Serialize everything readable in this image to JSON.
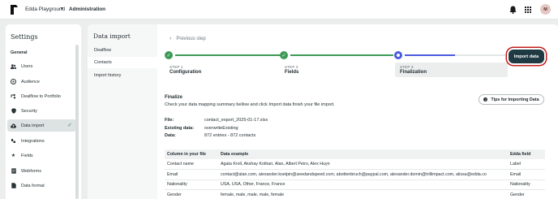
{
  "topbar": {
    "workspace": "Edda Playground",
    "section": "Administration",
    "avatar_initial": "M"
  },
  "settings": {
    "title": "Settings",
    "group": "General",
    "items": [
      {
        "label": "Users",
        "icon": "users-icon"
      },
      {
        "label": "Audience",
        "icon": "audience-icon"
      },
      {
        "label": "Dealflow to Portfolio",
        "icon": "flow-icon"
      },
      {
        "label": "Security",
        "icon": "shield-icon"
      },
      {
        "label": "Data import",
        "icon": "cloud-upload-icon",
        "active": true
      },
      {
        "label": "Integrations",
        "icon": "integrations-icon"
      },
      {
        "label": "Fields",
        "icon": "star-icon"
      },
      {
        "label": "Webforms",
        "icon": "form-icon"
      },
      {
        "label": "Data format",
        "icon": "document-icon"
      }
    ]
  },
  "subnav": {
    "title": "Data import",
    "items": [
      {
        "label": "Dealflow"
      },
      {
        "label": "Contacts",
        "active": true
      },
      {
        "label": "Import history"
      }
    ]
  },
  "main": {
    "previous_step": "Previous step",
    "steps": [
      {
        "num": "STEP 1",
        "name": "Configuration",
        "state": "done"
      },
      {
        "num": "STEP 2",
        "name": "Fields",
        "state": "done"
      },
      {
        "num": "STEP 3",
        "name": "Finalization",
        "state": "current"
      }
    ],
    "import_button": "Import data",
    "finalize_title": "Finalize",
    "finalize_desc": "Check your data mapping summary bellow and click Import data finish your file import.",
    "tips_button": "Tips for Importing Data",
    "meta": [
      {
        "key": "File:",
        "value": "contact_export_2025-01-17.xlsx"
      },
      {
        "key": "Existing data:",
        "value": "overwriteExisting"
      },
      {
        "key": "Data:",
        "value": "872 entries - 872 contacts"
      }
    ],
    "table": {
      "headers": [
        "Column in your file",
        "Data example",
        "Edda field"
      ],
      "rows": [
        [
          "Contact name",
          "Agata Kroll, Akshay Kothari, Alan, Albert Peiro, Alex Huyn",
          "Label"
        ],
        [
          "Email",
          "contact@alan.com, alexander.koelpin@seedandspeed.com, abottenbruch@paypal.com, alexander.domin@trillimpact.com, alissa@edda.co",
          "Email"
        ],
        [
          "Nationality",
          "USA, USA, Other, France, France",
          "Nationality"
        ],
        [
          "Gender",
          "female, male, male, male, female",
          "Gender"
        ]
      ]
    }
  },
  "colors": {
    "accent_green": "#3d9a55",
    "accent_blue": "#4a5be0",
    "button_dark": "#203a43",
    "highlight_red": "#c51d1d"
  }
}
